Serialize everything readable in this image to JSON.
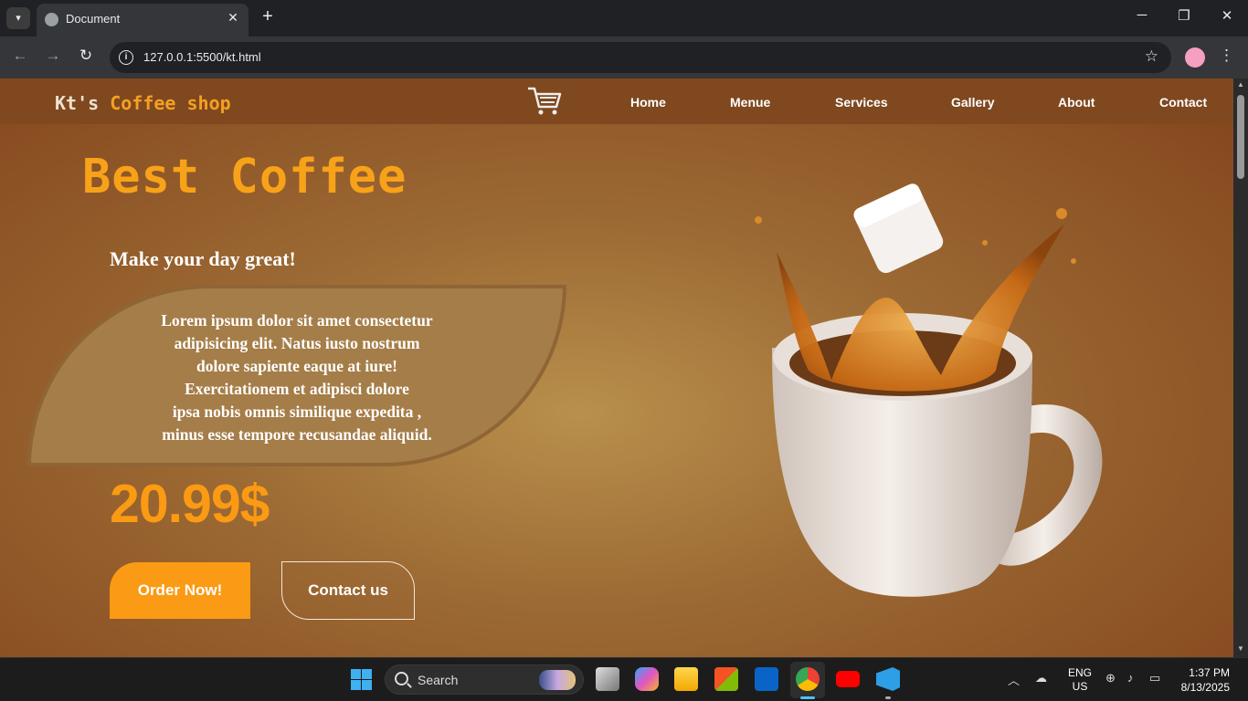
{
  "browser": {
    "tab_title": "Document",
    "url": "127.0.0.1:5500/kt.html",
    "new_tab_label": "+",
    "close_tab_label": "✕"
  },
  "site": {
    "brand_prefix": "Kt's",
    "brand_accent": "Coffee shop",
    "nav": [
      "Home",
      "Menue",
      "Services",
      "Gallery",
      "About",
      "Contact"
    ],
    "hero_title": "Best Coffee",
    "tagline": "Make your day great!",
    "description_lines": [
      "Lorem ipsum dolor sit amet consectetur",
      "adipisicing elit. Natus iusto nostrum",
      "dolore sapiente eaque at iure!",
      "Exercitationem et adipisci dolore",
      "ipsa nobis omnis similique expedita ,",
      "minus esse tempore recusandae aliquid."
    ],
    "price": "20.99$",
    "order_button": "Order Now!",
    "contact_button": "Contact us",
    "colors": {
      "accent": "#fb9a14",
      "nav_bg": "#7f481f"
    }
  },
  "taskbar": {
    "search_placeholder": "Search",
    "lang_line1": "ENG",
    "lang_line2": "US",
    "time": "1:37 PM",
    "date": "8/13/2025",
    "apps": [
      "task-view",
      "copilot",
      "file-explorer",
      "microsoft-store",
      "outlook",
      "chrome",
      "youtube",
      "vscode"
    ]
  }
}
